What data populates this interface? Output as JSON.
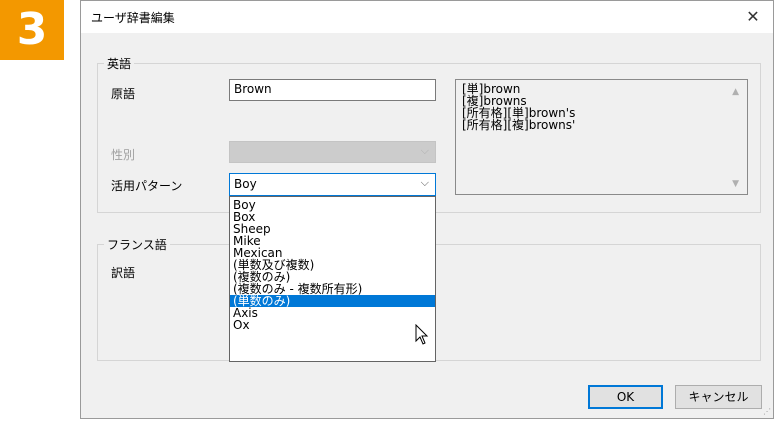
{
  "step_badge": "3",
  "dialog": {
    "title": "ユーザ辞書編集",
    "close_glyph": "✕"
  },
  "english": {
    "group_label": "英語",
    "original_label": "原語",
    "original_value": "Brown",
    "gender_label": "性別",
    "gender_value": "",
    "pattern_label": "活用パターン",
    "pattern_value": "Boy",
    "forms": [
      "[単]brown",
      "[複]browns",
      "[所有格][単]brown's",
      "[所有格][複]browns'"
    ]
  },
  "dropdown": {
    "items": [
      "Boy",
      "Box",
      "Sheep",
      "Mike",
      "Mexican",
      "(単数及び複数)",
      "(複数のみ)",
      "(複数のみ - 複数所有形)",
      "(単数のみ)",
      "Axis",
      "Ox"
    ],
    "selected_index": 8
  },
  "french": {
    "group_label": "フランス語",
    "translation_label": "訳語"
  },
  "buttons": {
    "ok": "OK",
    "cancel": "キャンセル"
  },
  "colors": {
    "badge": "#f39800",
    "accent": "#0078d7"
  }
}
